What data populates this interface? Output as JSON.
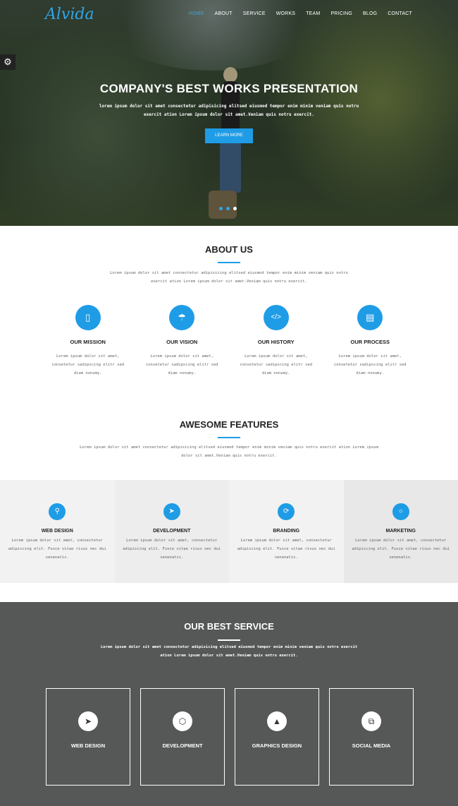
{
  "header": {
    "logo": "Alvida",
    "nav": [
      "HOME",
      "ABOUT",
      "SERVICE",
      "WORKS",
      "TEAM",
      "PRICING",
      "BLOG",
      "CONTACT"
    ]
  },
  "hero": {
    "title": "COMPANY'S BEST WORKS PRESENTATION",
    "text": "lorem ipsum dolor sit amet consectetur adipisicing elitsed eiusmod tempor enim minim veniam quis notru exercit ation Lorem ipsum dolor sit amet.Veniam quis notru exercit.",
    "button": "LEARN MORE"
  },
  "about": {
    "title": "ABOUT US",
    "text": "Lorem ipsum dolor sit amet consectetur adipisicing elitsed eiusmod tempor enim minim veniam quis notru exercit ation Lorem ipsum dolor sit amet.Veniam quis notru exercit.",
    "items": [
      {
        "title": "OUR MISSION",
        "text": "Lorem ipsum dolor sit amet, consetetur sadipscing elitr sed diam nonumy."
      },
      {
        "title": "OUR VISION",
        "text": "Lorem ipsum dolor sit amet, consetetur sadipscing elitr sed diam nonumy."
      },
      {
        "title": "OUR HISTORY",
        "text": "Lorem ipsum dolor sit amet, consetetur sadipscing elitr sed diam nonumy."
      },
      {
        "title": "OUR PROCESS",
        "text": "Lorem ipsum dolor sit amet, consetetur sadipscing elitr sed diam nonumy."
      }
    ]
  },
  "features": {
    "title": "AWESOME FEATURES",
    "text": "Lorem ipsum dolor sit amet consectetur adipisicing elitsed eiusmod tempor enim minim veniam quis notru exercit ation Lorem ipsum dolor sit amet.Veniam quis notru exercit.",
    "items": [
      {
        "title": "WEB DESIGN",
        "text": "Lorem ipsum dolor sit amet, consectetur adipiscing elit. Fusce vitae risus nec dui venenatis."
      },
      {
        "title": "DEVELOPMENT",
        "text": "Lorem ipsum dolor sit amet, consectetur adipiscing elit. Fusce vitae risus nec dui venenatis."
      },
      {
        "title": "BRANDING",
        "text": "Lorem ipsum dolor sit amet, consectetur adipiscing elit. Fusce vitae risus nec dui venenatis."
      },
      {
        "title": "MARKETING",
        "text": "Lorem ipsum dolor sit amet, consectetur adipiscing elit. Fusce vitae risus nec dui venenatis."
      }
    ]
  },
  "service": {
    "title": "OUR BEST SERVICE",
    "text": "Lorem ipsum dolor sit amet consectetur adipisicing elitsed eiusmod tempor enim minim veniam quis notru exercit ation Lorem ipsum dolor sit amet.Veniam quis notru exercit.",
    "items": [
      {
        "title": "WEB DESIGN"
      },
      {
        "title": "DEVELOPMENT"
      },
      {
        "title": "GRAPHICS DESIGN"
      },
      {
        "title": "SOCIAL MEDIA"
      }
    ]
  },
  "icons": {
    "settings": "gear-icon",
    "about": [
      "tablet-icon",
      "umbrella-icon",
      "code-icon",
      "document-icon"
    ],
    "features": [
      "location-pin-icon",
      "rocket-icon",
      "refresh-icon",
      "circle-icon"
    ],
    "service": [
      "paper-plane-icon",
      "hexagon-icon",
      "tree-icon",
      "share-icon"
    ]
  },
  "colors": {
    "accent": "#1f9ce6",
    "dark": "#555857"
  }
}
